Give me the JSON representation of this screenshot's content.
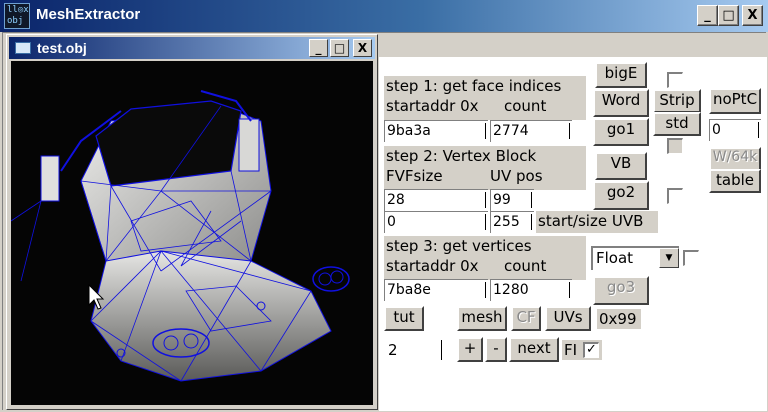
{
  "app": {
    "title": "MeshExtractor",
    "icon_text": "ll◎x\nobj",
    "icon": "app-icon"
  },
  "window_buttons": {
    "minimize": "_",
    "maximize": "□",
    "close": "X"
  },
  "child": {
    "title": "test.obj",
    "icon": "document-icon"
  },
  "step1": {
    "heading": "step 1: get face indices",
    "startaddr_label": "startaddr 0x",
    "count_label": "count",
    "startaddr_value": "9ba3a",
    "count_value": "2774"
  },
  "step2": {
    "heading": "step 2: Vertex Block",
    "fvfsize_label": "FVFsize",
    "uvpos_label": "UV pos",
    "fvfsize_value": "28",
    "uvpos_value": "99",
    "start_value": "0",
    "size_value": "255",
    "start_size_label": "start/size UVB"
  },
  "step3": {
    "heading": "step 3: get vertices",
    "startaddr_label": "startaddr 0x",
    "count_label": "count",
    "startaddr_value": "7ba8e",
    "count_value": "1280"
  },
  "buttons": {
    "bigE": "bigE",
    "word": "Word",
    "go1": "go1",
    "strip": "Strip",
    "std": "std",
    "noPtC": "noPtC",
    "vb": "VB",
    "go2": "go2",
    "w64k": "W/64k",
    "table": "table",
    "go3": "go3",
    "tut": "tut",
    "mesh": "mesh",
    "cf": "CF",
    "uvs": "UVs",
    "plus": "+",
    "minus": "-",
    "next": "next"
  },
  "noptc_value": "0",
  "format_select": {
    "selected": "Float"
  },
  "uv_offset_label": "0x99",
  "next_value": "2",
  "fi_label": "FI",
  "fi_checked": "✓",
  "colors": {
    "titlebar": "#0a246a",
    "face": "#d4d0c8",
    "wire": "#1010e0"
  }
}
